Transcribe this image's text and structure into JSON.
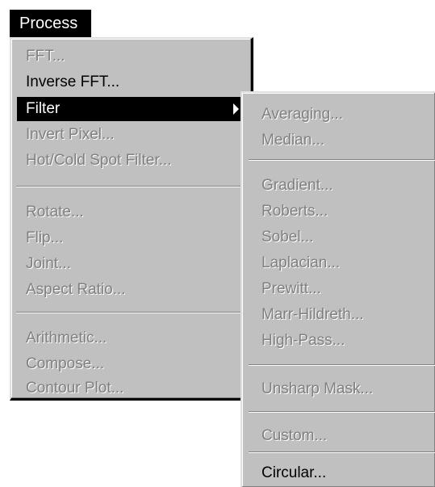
{
  "menubar": {
    "title": "Process"
  },
  "main_menu": {
    "items": [
      {
        "label": "FFT..."
      },
      {
        "label": "Inverse FFT..."
      },
      {
        "label": "Filter"
      },
      {
        "label": "Invert Pixel..."
      },
      {
        "label": "Hot/Cold Spot Filter..."
      },
      {
        "label": "Rotate..."
      },
      {
        "label": "Flip..."
      },
      {
        "label": "Joint..."
      },
      {
        "label": "Aspect Ratio..."
      },
      {
        "label": "Arithmetic..."
      },
      {
        "label": "Compose..."
      },
      {
        "label": "Contour Plot..."
      }
    ]
  },
  "filter_submenu": {
    "items": [
      {
        "label": "Averaging..."
      },
      {
        "label": "Median..."
      },
      {
        "label": "Gradient..."
      },
      {
        "label": "Roberts..."
      },
      {
        "label": "Sobel..."
      },
      {
        "label": "Laplacian..."
      },
      {
        "label": "Prewitt..."
      },
      {
        "label": "Marr-Hildreth..."
      },
      {
        "label": "High-Pass..."
      },
      {
        "label": "Unsharp Mask..."
      },
      {
        "label": "Custom..."
      },
      {
        "label": "Circular..."
      }
    ]
  },
  "colors": {
    "menu_bg": "#c0c0c0",
    "highlight": "#000000",
    "disabled_text": "#808080"
  },
  "icons": {
    "submenu_arrow": "triangle-right"
  }
}
